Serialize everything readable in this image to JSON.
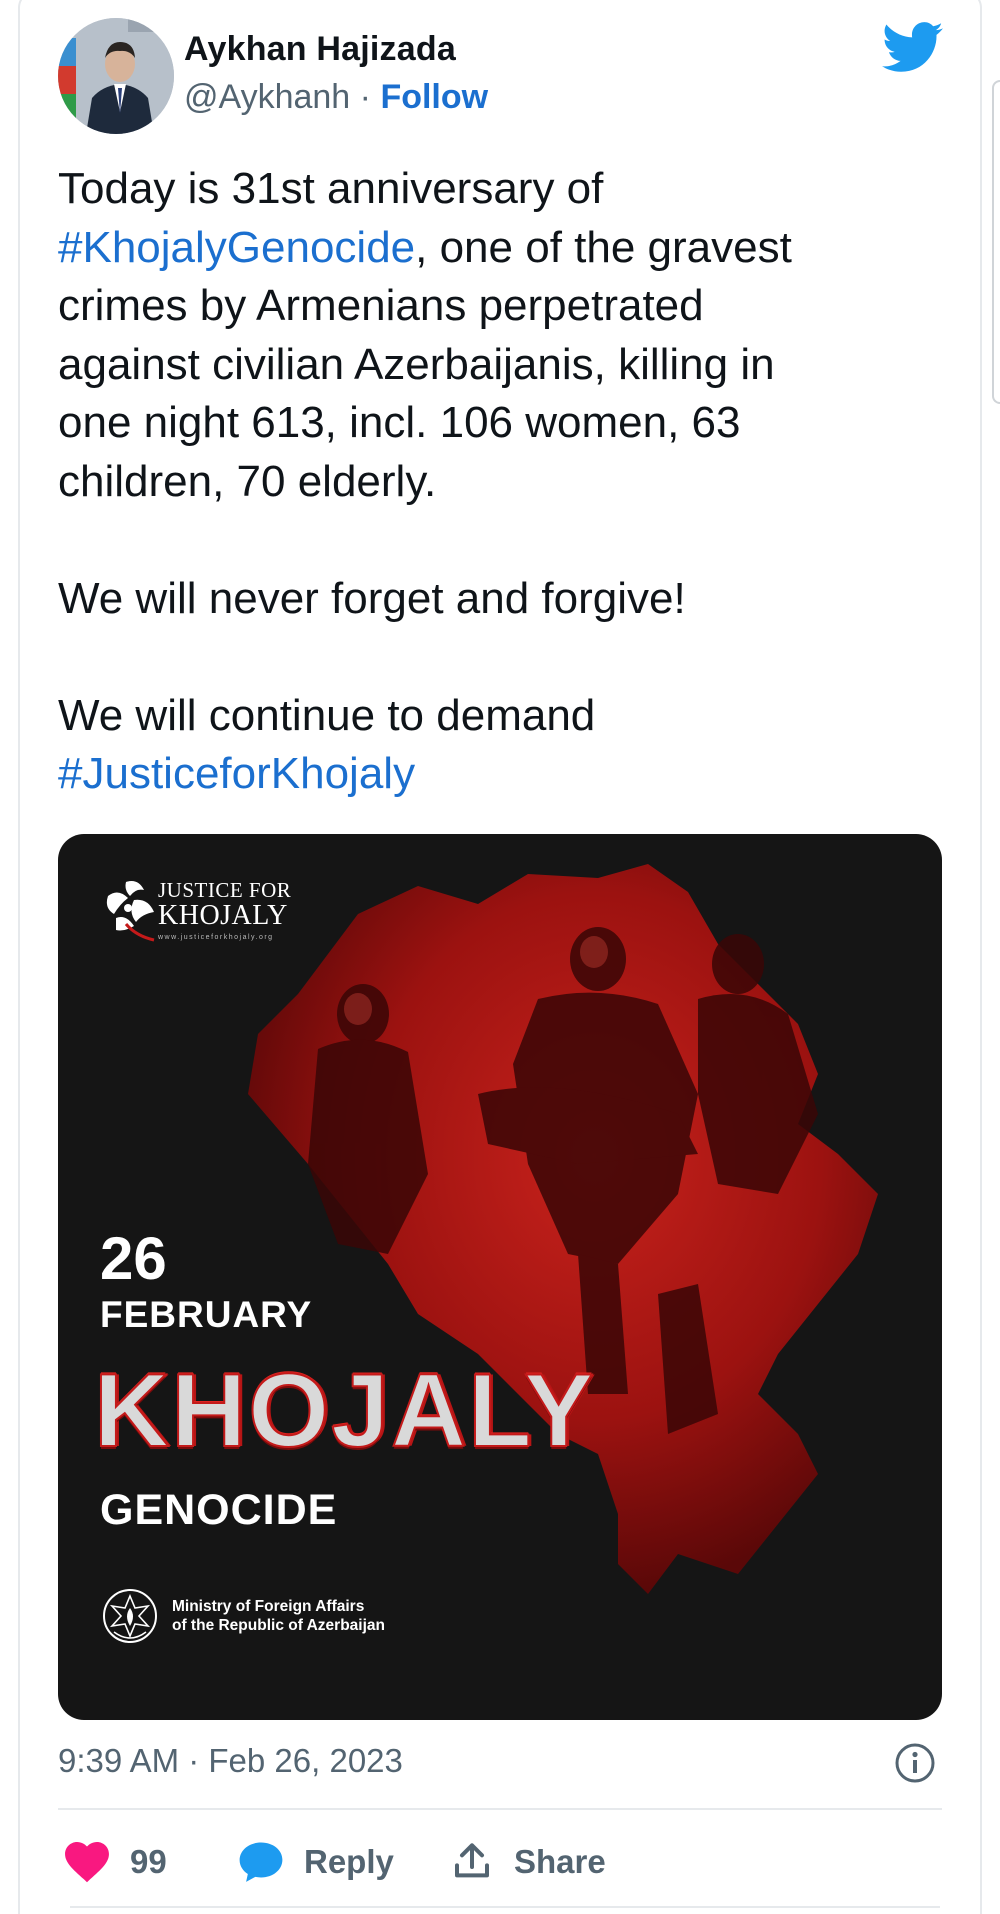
{
  "author": {
    "name": "Aykhan Hajizada",
    "handle": "@Aykhanh",
    "separator": "·",
    "follow_label": "Follow"
  },
  "tweet": {
    "line1_pre": "Today is 31st anniversary of",
    "hashtag1": "#KhojalyGenocide",
    "line2_post": ", one of the gravest",
    "line3": "crimes by Armenians perpetrated",
    "line4": "against civilian Azerbaijanis, killing in",
    "line5": "one night 613, incl. 106 women, 63",
    "line6": "children, 70 elderly.",
    "para2": "We will never forget and forgive!",
    "para3_pre": "We will continue to demand",
    "hashtag2": "#JusticeforKhojaly"
  },
  "media": {
    "logo_line1": "JUSTICE FOR",
    "logo_line2": "KHOJALY",
    "logo_url": "www.justiceforkhojaly.org",
    "day": "26",
    "month": "FEBRUARY",
    "title": "KHOJALY",
    "subtitle": "GENOCIDE",
    "ministry_line1": "Ministry of Foreign Affairs",
    "ministry_line2": "of the Republic of Azerbaijan",
    "accent_color": "#c41a1a"
  },
  "meta": {
    "timestamp": "9:39 AM · Feb 26, 2023"
  },
  "actions": {
    "like_count": "99",
    "reply_label": "Reply",
    "share_label": "Share"
  },
  "colors": {
    "link": "#1b6fcf",
    "text": "#0f1419",
    "muted": "#536471",
    "like": "#f91880",
    "reply": "#1d9bf0",
    "twitter": "#1d9bf0"
  },
  "icons": [
    "twitter-bird-icon",
    "info-icon",
    "heart-icon",
    "reply-bubble-icon",
    "share-icon"
  ]
}
